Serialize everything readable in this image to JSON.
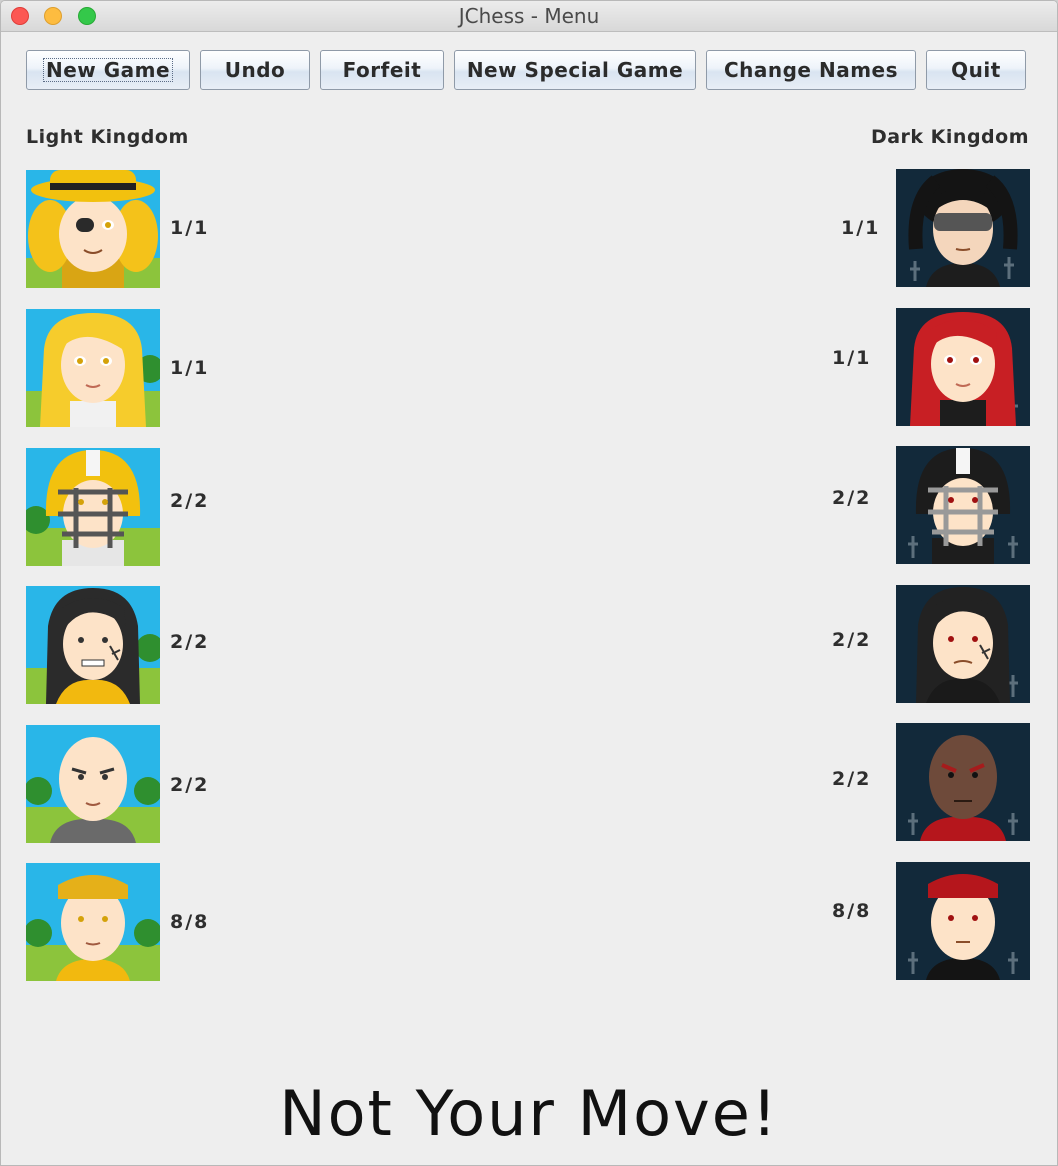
{
  "window": {
    "title": "JChess - Menu"
  },
  "toolbar": {
    "new_game": "New Game",
    "undo": "Undo",
    "forfeit": "Forfeit",
    "new_special_game": "New Special Game",
    "change_names": "Change Names",
    "quit": "Quit"
  },
  "light_kingdom": {
    "title": "Light Kingdom",
    "pieces": [
      {
        "icon": "eyepatch-pirate-avatar-icon",
        "count": "1/1"
      },
      {
        "icon": "blonde-queen-avatar-icon",
        "count": "1/1"
      },
      {
        "icon": "football-helmet-avatar-icon",
        "count": "2/2"
      },
      {
        "icon": "dark-haired-scarred-avatar-icon",
        "count": "2/2"
      },
      {
        "icon": "bald-monk-avatar-icon",
        "count": "2/2"
      },
      {
        "icon": "headband-fighter-avatar-icon",
        "count": "8/8"
      }
    ]
  },
  "dark_kingdom": {
    "title": "Dark Kingdom",
    "pieces": [
      {
        "icon": "sunglasses-avatar-icon",
        "count": "1/1"
      },
      {
        "icon": "red-haired-queen-avatar-icon",
        "count": "1/1"
      },
      {
        "icon": "football-helmet-avatar-icon",
        "count": "2/2"
      },
      {
        "icon": "dark-haired-scarred-avatar-icon",
        "count": "2/2"
      },
      {
        "icon": "bald-monk-avatar-icon",
        "count": "2/2"
      },
      {
        "icon": "headband-fighter-avatar-icon",
        "count": "8/8"
      }
    ]
  },
  "status": {
    "message": "Not Your Move!"
  },
  "colors": {
    "light_sky": "#29b6e8",
    "light_grass": "#8cc43c",
    "dark_sky": "#12293a",
    "gold": "#f2c10e",
    "dark_red": "#b5161c"
  }
}
